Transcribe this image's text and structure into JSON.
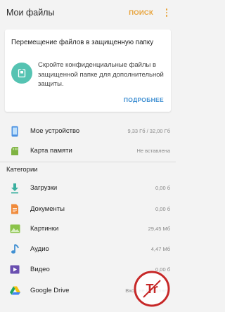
{
  "header": {
    "title": "Мои файлы",
    "search_label": "ПОИСК",
    "more_icon": "more-vert-icon",
    "accent": "#e8a33a"
  },
  "secure_card": {
    "title": "Перемещение файлов в защищенную папку",
    "text": "Скройте конфиденциальные файлы в защищенной папке для дополнительной защиты.",
    "more_label": "ПОДРОБНЕЕ",
    "icon": "lock-icon",
    "icon_color": "#55c3b2",
    "link_color": "#3f8fd2"
  },
  "storage": [
    {
      "label": "Мое устройство",
      "meta": "9,33 Гб / 32,00 Гб",
      "icon": "phone-icon"
    },
    {
      "label": "Карта памяти",
      "meta": "Не вставлена",
      "icon": "sd-card-icon"
    }
  ],
  "categories": {
    "header": "Категории",
    "items": [
      {
        "label": "Загрузки",
        "meta": "0,00 б",
        "icon": "download-icon"
      },
      {
        "label": "Документы",
        "meta": "0,00 б",
        "icon": "document-icon"
      },
      {
        "label": "Картинки",
        "meta": "29,45 Мб",
        "icon": "image-icon"
      },
      {
        "label": "Аудио",
        "meta": "4,47 Мб",
        "icon": "music-note-icon"
      },
      {
        "label": "Видео",
        "meta": "0,00 б",
        "icon": "video-icon"
      },
      {
        "label": "Google Drive",
        "meta": "Вход не выполнен",
        "icon": "google-drive-icon"
      }
    ]
  },
  "watermark": {
    "text": "Tr",
    "color": "#c62828"
  }
}
